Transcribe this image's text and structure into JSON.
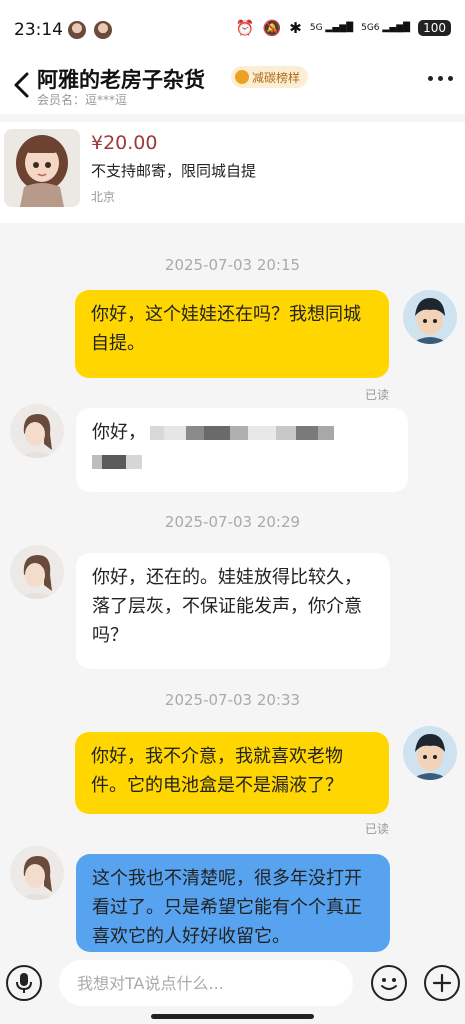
{
  "status_bar": {
    "time": "23:14",
    "battery": "100",
    "signal_a": "5G",
    "signal_b": "5G6"
  },
  "header": {
    "shop_name": "阿雅的老房子杂货",
    "badge": "减碳榜样",
    "member": "会员名：逗***逗"
  },
  "product": {
    "price": "¥20.00",
    "description": "不支持邮寄，限同城自提",
    "location": "北京"
  },
  "messages": [
    {
      "type": "time",
      "text": "2025-07-03 20:15"
    },
    {
      "type": "me",
      "text": "你好，这个娃娃还在吗？我想同城自提。",
      "read": "已读"
    },
    {
      "type": "other",
      "text": "你好，"
    },
    {
      "type": "time",
      "text": "2025-07-03 20:29"
    },
    {
      "type": "other",
      "text": "你好，还在的。娃娃放得比较久，落了层灰，不保证能发声，你介意吗？"
    },
    {
      "type": "time",
      "text": "2025-07-03 20:33"
    },
    {
      "type": "me",
      "text": "你好，我不介意，我就喜欢老物件。它的电池盒是不是漏液了？",
      "read": "已读"
    },
    {
      "type": "other",
      "text": "这个我也不清楚呢，很多年没打开看过了。只是希望它能有个个真正喜欢它的人好好收留它。"
    }
  ],
  "input": {
    "placeholder": "我想对TA说点什么..."
  },
  "colors": {
    "my_bubble": "#ffd600",
    "other_bubble": "#ffffff",
    "highlight_bubble": "#58a3ef",
    "price": "#9b3a3a"
  }
}
